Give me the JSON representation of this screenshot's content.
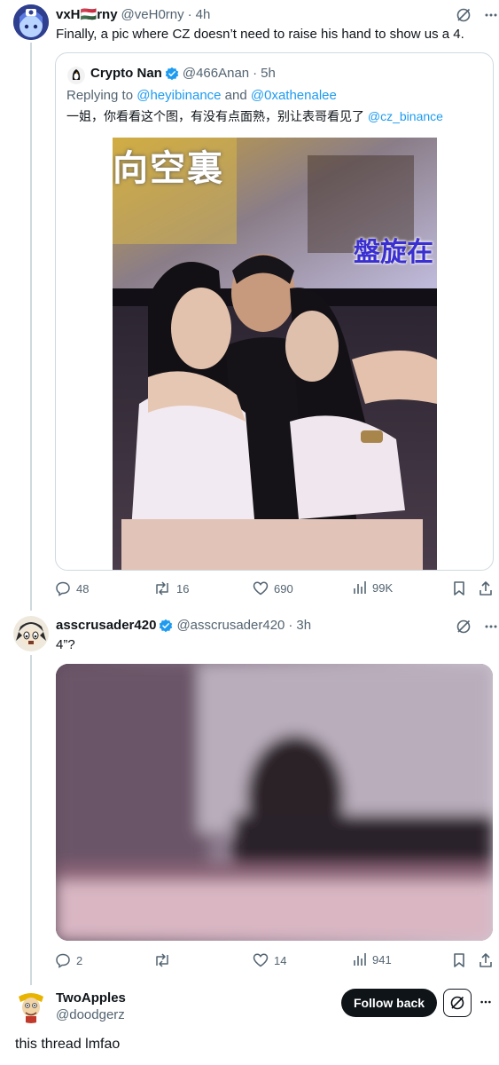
{
  "post1": {
    "display_name": "vxH🇭🇺rny",
    "handle": "@veH0rny",
    "dot": "·",
    "time": "4h",
    "text": "Finally, a pic where CZ doesn’t need to raise his hand to show us a 4.",
    "stats": {
      "replies": "48",
      "reposts": "16",
      "likes": "690",
      "views": "99K"
    }
  },
  "quote": {
    "display_name": "Crypto Nan",
    "handle": "@466Anan",
    "dot": "·",
    "time": "5h",
    "replying_prefix": "Replying to ",
    "replying_user1": "@heyibinance",
    "replying_and": " and ",
    "replying_user2": "@0xathenalee",
    "text_cn": "一姐，你看看这个图，有没有点面熟，别让表哥看见了 ",
    "text_mention": "@cz_binance",
    "photo_caption_left": "向空裏",
    "photo_caption_right": "盤旋在"
  },
  "post2": {
    "display_name": "asscrusader420",
    "handle": "@asscrusader420",
    "dot": "·",
    "time": "3h",
    "text": "4”?",
    "stats": {
      "replies": "2",
      "reposts": "",
      "likes": "14",
      "views": "941"
    }
  },
  "post3": {
    "display_name": "TwoApples",
    "handle": "@doodgerz",
    "follow_label": "Follow back",
    "text": "this thread lmfao"
  },
  "colors": {
    "text_primary": "#0f1419",
    "text_secondary": "#536471",
    "link": "#1d9bf0",
    "verified": "#1d9bf0",
    "border": "#cfd9de"
  }
}
